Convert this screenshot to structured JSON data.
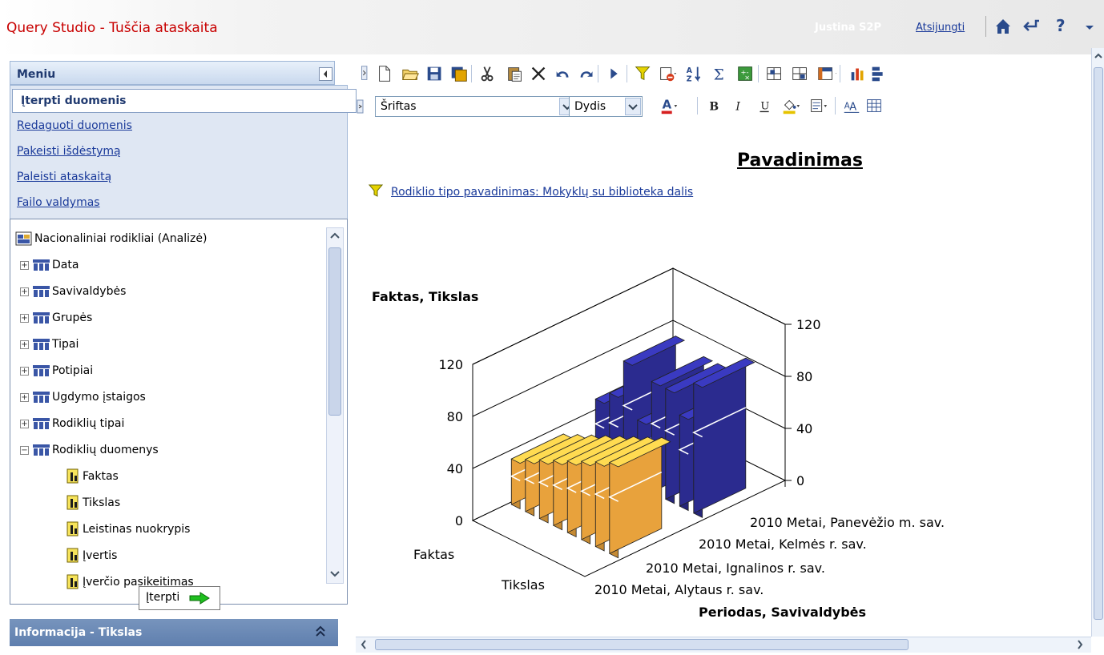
{
  "header": {
    "title": "Query Studio  - Tuščia ataskaita",
    "user": "Justina S2P",
    "logout": "Atsijungti",
    "icons": [
      "home-icon",
      "return-icon",
      "help-icon",
      "dropdown-arrow-icon"
    ]
  },
  "menu": {
    "heading": "Meniu",
    "items": [
      {
        "label": "Įterpti duomenis",
        "active": true
      },
      {
        "label": "Redaguoti duomenis"
      },
      {
        "label": "Pakeisti išdėstymą"
      },
      {
        "label": "Paleisti ataskaitą"
      },
      {
        "label": "Failo valdymas"
      }
    ]
  },
  "tree": {
    "root": "Nacionaliniai rodikliai (Analizė)",
    "dimensions": [
      "Data",
      "Savivaldybės",
      "Grupės",
      "Tipai",
      "Potipiai",
      "Ugdymo įstaigos",
      "Rodiklių tipai",
      "Rodiklių duomenys"
    ],
    "measures": [
      "Faktas",
      "Tikslas",
      "Leistinas nuokrypis",
      "Įvertis",
      "Įverčio pasikeitimas"
    ]
  },
  "insert_button": "Įterpti",
  "info_bar": "Informacija - Tikslas",
  "toolbar2": {
    "font_placeholder": "Šriftas",
    "size_placeholder": "Dydis"
  },
  "report": {
    "title": "Pavadinimas",
    "filter": "Rodiklio tipo pavadinimas: Mokyklų su biblioteka dalis"
  },
  "chart_data": {
    "type": "bar",
    "title": "Faktas, Tikslas",
    "xlabel": "Periodas, Savivaldybės",
    "series_axis_labels": [
      "Faktas",
      "Tikslas"
    ],
    "category_labels": [
      "2010 Metai, Alytaus r. sav.",
      "2010 Metai, Ignalinos r. sav.",
      "2010 Metai, Kelmės r. sav.",
      "2010 Metai, Panevėžio m. sav."
    ],
    "left_axis_ticks": [
      "0",
      "40",
      "80",
      "120"
    ],
    "right_axis_ticks": [
      "0",
      "40",
      "80",
      "120"
    ],
    "ylim": [
      0,
      120
    ],
    "series": [
      {
        "name": "Faktas",
        "color": "#2b2b8f",
        "values": [
          50,
          60,
          90,
          50,
          85,
          85,
          70,
          100
        ]
      },
      {
        "name": "Tikslas",
        "color": "#e8a23c",
        "values": [
          35,
          40,
          45,
          50,
          55,
          60,
          65,
          70
        ]
      }
    ]
  }
}
